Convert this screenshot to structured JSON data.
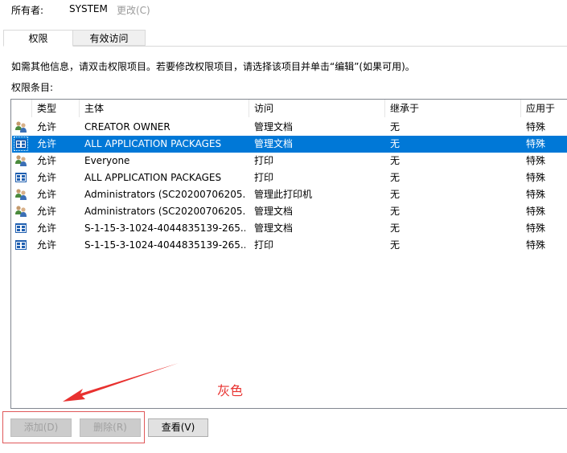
{
  "owner": {
    "label": "所有者:",
    "value": "SYSTEM",
    "change": "更改(C)"
  },
  "tabs": [
    {
      "label": "权限"
    },
    {
      "label": "有效访问"
    }
  ],
  "info_text": "如需其他信息，请双击权限项目。若要修改权限项目，请选择该项目并单击“编辑”(如果可用)。",
  "entries_label": "权限条目:",
  "table": {
    "columns": [
      "类型",
      "主体",
      "访问",
      "继承于",
      "应用于"
    ],
    "rows": [
      {
        "icon": "user-group-icon",
        "type": "允许",
        "principal": "CREATOR OWNER",
        "access": "管理文档",
        "inherited": "无",
        "applies": "特殊",
        "selected": false
      },
      {
        "icon": "app-package-icon",
        "type": "允许",
        "principal": "ALL APPLICATION PACKAGES",
        "access": "管理文档",
        "inherited": "无",
        "applies": "特殊",
        "selected": true
      },
      {
        "icon": "user-group-icon",
        "type": "允许",
        "principal": "Everyone",
        "access": "打印",
        "inherited": "无",
        "applies": "特殊",
        "selected": false
      },
      {
        "icon": "app-package-icon",
        "type": "允许",
        "principal": "ALL APPLICATION PACKAGES",
        "access": "打印",
        "inherited": "无",
        "applies": "特殊",
        "selected": false
      },
      {
        "icon": "user-group-icon",
        "type": "允许",
        "principal": "Administrators (SC20200706205...",
        "access": "管理此打印机",
        "inherited": "无",
        "applies": "特殊",
        "selected": false
      },
      {
        "icon": "user-group-icon",
        "type": "允许",
        "principal": "Administrators (SC20200706205...",
        "access": "管理文档",
        "inherited": "无",
        "applies": "特殊",
        "selected": false
      },
      {
        "icon": "app-package-icon",
        "type": "允许",
        "principal": "S-1-15-3-1024-4044835139-265...",
        "access": "管理文档",
        "inherited": "无",
        "applies": "特殊",
        "selected": false
      },
      {
        "icon": "app-package-icon",
        "type": "允许",
        "principal": "S-1-15-3-1024-4044835139-265...",
        "access": "打印",
        "inherited": "无",
        "applies": "特殊",
        "selected": false
      }
    ]
  },
  "annotation": {
    "text": "灰色",
    "color": "#e8312f"
  },
  "buttons": {
    "add": "添加(D)",
    "remove": "删除(R)",
    "view": "查看(V)"
  },
  "colors": {
    "selection": "#0078d7",
    "annotation": "#e8312f",
    "disabled_text": "#a0a0a0"
  }
}
